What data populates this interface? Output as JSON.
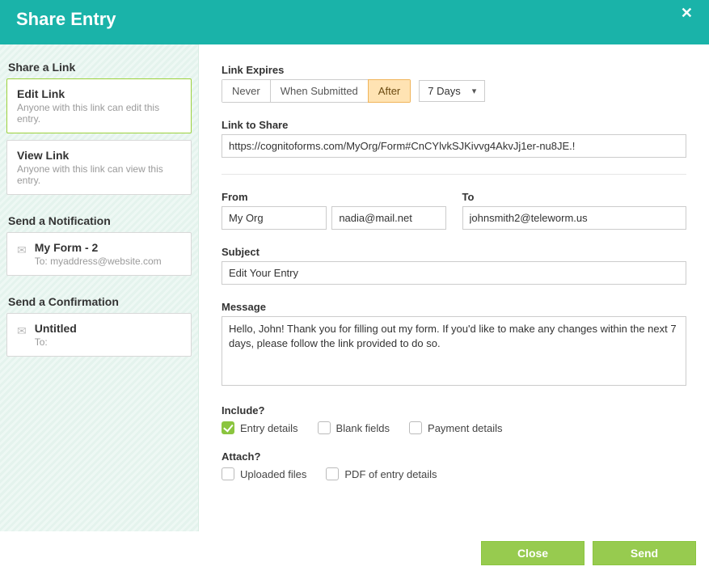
{
  "header": {
    "title": "Share Entry",
    "close_icon": "✕"
  },
  "sidebar": {
    "share_link_title": "Share a Link",
    "items": [
      {
        "title": "Edit Link",
        "sub": "Anyone with this link can edit this entry."
      },
      {
        "title": "View Link",
        "sub": "Anyone with this link can view this entry."
      }
    ],
    "notif_title": "Send a Notification",
    "notifs": [
      {
        "title": "My Form - 2",
        "to": "To: myaddress@website.com"
      }
    ],
    "confirm_title": "Send a Confirmation",
    "confirms": [
      {
        "title": "Untitled",
        "to": "To:"
      }
    ]
  },
  "main": {
    "link_expires_label": "Link Expires",
    "expiry_options": {
      "never": "Never",
      "when_submitted": "When Submitted",
      "after": "After"
    },
    "expiry_selected": "after",
    "expiry_duration": "7 Days",
    "link_share_label": "Link to Share",
    "link_share_value": "https://cognitoforms.com/MyOrg/Form#CnCYlvkSJKivvg4AkvJj1er-nu8JE.!",
    "from_label": "From",
    "from_org": "My Org",
    "from_email": "nadia@mail.net",
    "to_label": "To",
    "to_value": "johnsmith2@teleworm.us",
    "subject_label": "Subject",
    "subject_value": "Edit Your Entry",
    "message_label": "Message",
    "message_value": "Hello, John! Thank you for filling out my form. If you'd like to make any changes within the next 7 days, please follow the link provided to do so.",
    "include_label": "Include?",
    "include_opts": {
      "entry_details": {
        "label": "Entry details",
        "checked": true
      },
      "blank_fields": {
        "label": "Blank fields",
        "checked": false
      },
      "payment_details": {
        "label": "Payment details",
        "checked": false
      }
    },
    "attach_label": "Attach?",
    "attach_opts": {
      "uploaded_files": {
        "label": "Uploaded files",
        "checked": false
      },
      "pdf_of_entry": {
        "label": "PDF of entry details",
        "checked": false
      }
    }
  },
  "footer": {
    "close": "Close",
    "send": "Send"
  }
}
